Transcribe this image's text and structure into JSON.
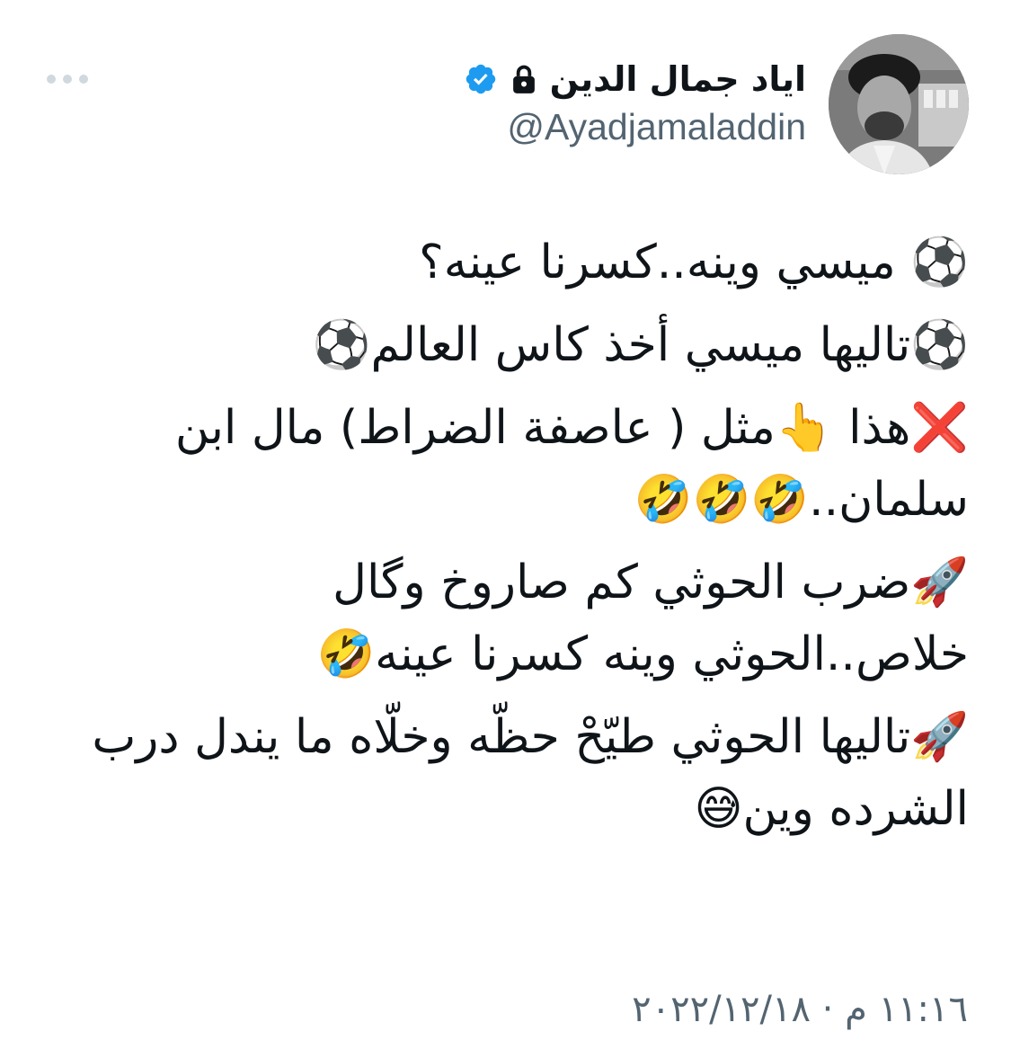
{
  "author": {
    "display_name": "اياد جمال الدين",
    "handle": "@Ayadjamaladdin",
    "verified": true,
    "protected": true,
    "avatar_icon": "profile-photo",
    "verified_color": "#1d9bf0"
  },
  "header": {
    "more_icon": "more-horizontal-icon"
  },
  "tweet": {
    "paragraphs": [
      "⚽️ ميسي وينه..كسرنا عينه؟",
      "⚽️تاليها ميسي أخذ كاس العالم⚽️",
      "❌هذا 👆مثل ( عاصفة الضراط) مال ابن سلمان..🤣🤣🤣",
      "🚀ضرب الحوثي كم صاروخ وگال خلاص..الحوثي وينه كسرنا عينه🤣",
      "🚀تاليها الحوثي طيّحْ حظّه وخلّاه ما يندل درب الشرده وين😅"
    ],
    "timestamp": "١١:١٦ م · ٢٠٢٢/١٢/١٨"
  },
  "colors": {
    "text_primary": "#0f1419",
    "text_secondary": "#536471"
  }
}
